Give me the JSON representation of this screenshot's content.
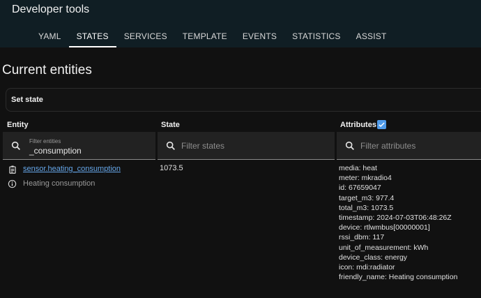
{
  "app": {
    "title": "Developer tools"
  },
  "tabs": [
    {
      "label": "YAML",
      "active": false
    },
    {
      "label": "STATES",
      "active": true
    },
    {
      "label": "SERVICES",
      "active": false
    },
    {
      "label": "TEMPLATE",
      "active": false
    },
    {
      "label": "EVENTS",
      "active": false
    },
    {
      "label": "STATISTICS",
      "active": false
    },
    {
      "label": "ASSIST",
      "active": false
    }
  ],
  "page": {
    "heading": "Current entities"
  },
  "set_state": {
    "label": "Set state"
  },
  "table": {
    "columns": {
      "entity": "Entity",
      "state": "State",
      "attributes": "Attributes"
    },
    "attributes_checkbox_checked": true,
    "filters": {
      "entity": {
        "label": "Filter entities",
        "value": "_consumption"
      },
      "state": {
        "placeholder": "Filter states"
      },
      "attributes": {
        "placeholder": "Filter attributes"
      }
    },
    "rows": [
      {
        "entity_id": "sensor.heating_consumption",
        "friendly_name": "Heating consumption",
        "state": "1073.5",
        "attributes": [
          "media: heat",
          "meter: mkradio4",
          "id: 67659047",
          "target_m3: 977.4",
          "total_m3: 1073.5",
          "timestamp: 2024-07-03T06:48:26Z",
          "device: rtlwmbus[00000001]",
          "rssi_dbm: 117",
          "unit_of_measurement: kWh",
          "device_class: energy",
          "icon: mdi:radiator",
          "friendly_name: Heating consumption"
        ]
      }
    ]
  },
  "colors": {
    "header_bg": "#101e24",
    "page_bg": "#111111",
    "link": "#66a7ea",
    "checkbox": "#4f9bea"
  }
}
